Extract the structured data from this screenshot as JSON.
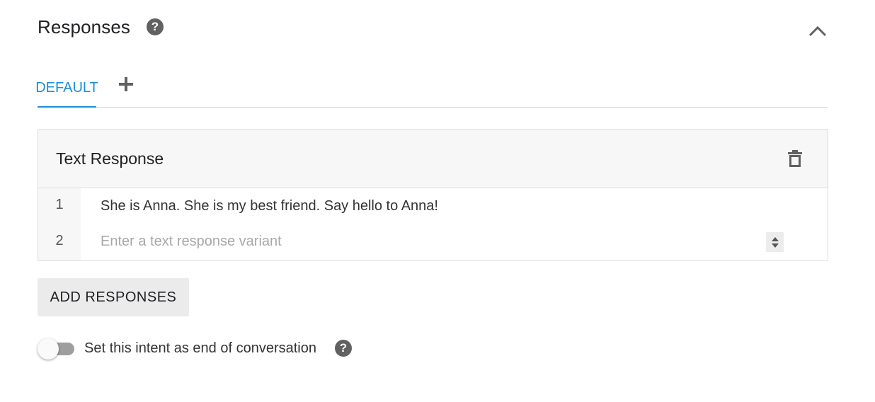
{
  "section": {
    "title": "Responses",
    "help_icon": "help-circle-icon",
    "collapse_icon": "chevron-up-icon"
  },
  "tabs": {
    "items": [
      {
        "label": "DEFAULT",
        "active": true
      }
    ],
    "add_icon": "plus-icon"
  },
  "card": {
    "title": "Text Response",
    "delete_icon": "trash-icon",
    "rows": [
      {
        "number": "1",
        "text": "She is Anna. She is my best friend. Say hello to Anna!"
      },
      {
        "number": "2",
        "placeholder": "Enter a text response variant"
      }
    ]
  },
  "add_button": {
    "label": "ADD RESPONSES"
  },
  "end_toggle": {
    "label": "Set this intent as end of conversation",
    "on": false,
    "help_icon": "help-circle-icon"
  },
  "colors": {
    "accent": "#1a8fd6",
    "icon": "#616161",
    "header_bg": "#f7f7f7",
    "button_bg": "#ebebeb",
    "toggle_track": "#9e9e9e"
  }
}
